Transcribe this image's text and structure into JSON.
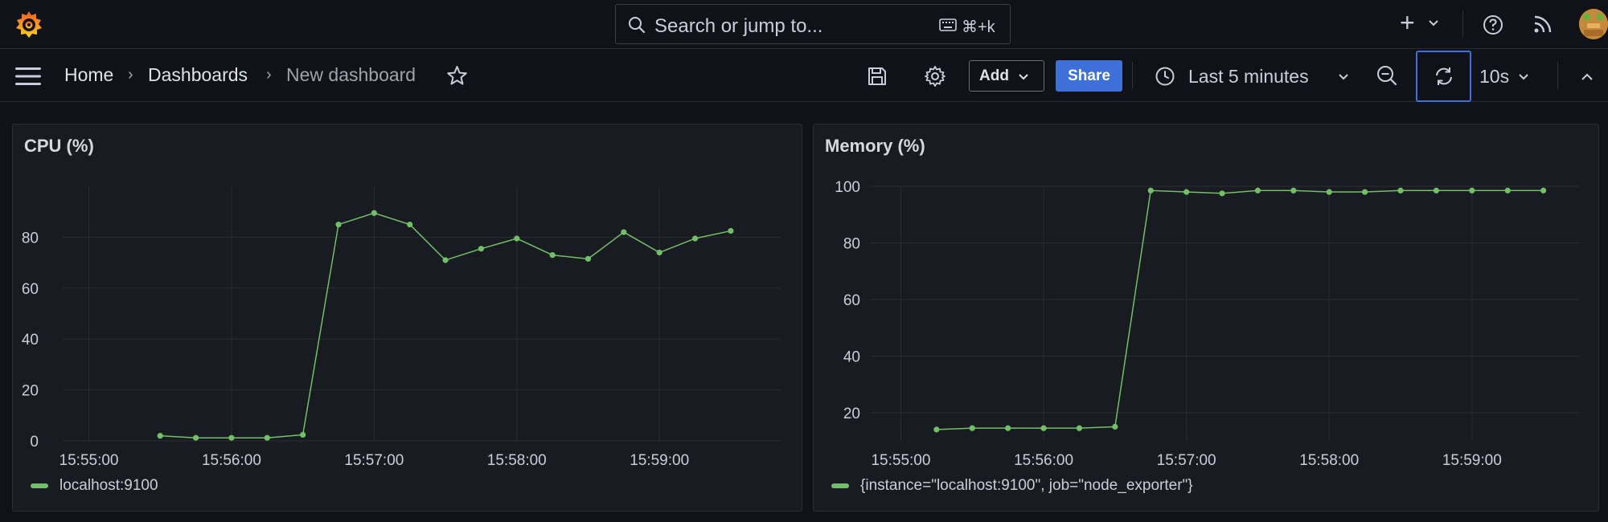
{
  "topbar": {
    "search_placeholder": "Search or jump to...",
    "search_shortcut": "⌘+k",
    "plus_label": "+"
  },
  "breadcrumb": {
    "home": "Home",
    "dashboards": "Dashboards",
    "current": "New dashboard",
    "separator": "›"
  },
  "toolbar": {
    "add_label": "Add",
    "share_label": "Share",
    "time_range": "Last 5 minutes",
    "refresh_interval": "10s"
  },
  "colors": {
    "series": "#73bf69",
    "share": "#3d71d9",
    "grid": "#2b2d33"
  },
  "chart_data": [
    {
      "type": "line",
      "title": "CPU (%)",
      "xlabel": "",
      "ylabel": "",
      "x_ticks": [
        "15:55:00",
        "15:56:00",
        "15:57:00",
        "15:58:00",
        "15:59:00"
      ],
      "ylim": [
        0,
        100
      ],
      "y_ticks": [
        0,
        20,
        40,
        60,
        80
      ],
      "grid": true,
      "legend": "bottom-left",
      "series": [
        {
          "name": "localhost:9100",
          "x": [
            "15:55:30",
            "15:55:45",
            "15:56:00",
            "15:56:15",
            "15:56:30",
            "15:56:45",
            "15:57:00",
            "15:57:15",
            "15:57:30",
            "15:57:45",
            "15:58:00",
            "15:58:15",
            "15:58:30",
            "15:58:45",
            "15:59:00",
            "15:59:15",
            "15:59:30"
          ],
          "values": [
            2,
            1.2,
            1.2,
            1.2,
            2.4,
            85,
            89.5,
            85,
            71,
            75.5,
            79.5,
            73,
            71.5,
            82,
            74,
            79.5,
            82.5
          ]
        }
      ]
    },
    {
      "type": "line",
      "title": "Memory (%)",
      "xlabel": "",
      "ylabel": "",
      "x_ticks": [
        "15:55:00",
        "15:56:00",
        "15:57:00",
        "15:58:00",
        "15:59:00"
      ],
      "ylim": [
        10,
        100
      ],
      "y_ticks": [
        20,
        40,
        60,
        80,
        100
      ],
      "grid": true,
      "legend": "bottom-left",
      "series": [
        {
          "name": "{instance=\"localhost:9100\", job=\"node_exporter\"}",
          "x": [
            "15:55:15",
            "15:55:30",
            "15:55:45",
            "15:56:00",
            "15:56:15",
            "15:56:30",
            "15:56:45",
            "15:57:00",
            "15:57:15",
            "15:57:30",
            "15:57:45",
            "15:58:00",
            "15:58:15",
            "15:58:30",
            "15:58:45",
            "15:59:00",
            "15:59:15",
            "15:59:30"
          ],
          "values": [
            14,
            14.5,
            14.5,
            14.5,
            14.5,
            15,
            98.5,
            98,
            97.5,
            98.5,
            98.5,
            98,
            98,
            98.5,
            98.5,
            98.5,
            98.5,
            98.5
          ]
        }
      ]
    }
  ]
}
